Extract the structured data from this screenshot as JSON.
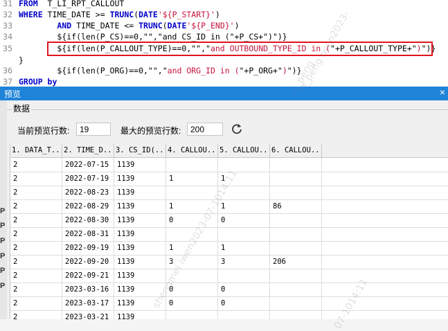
{
  "editor": {
    "lines": [
      {
        "num": "31",
        "segments": [
          [
            "kw",
            "FROM"
          ],
          [
            "",
            "  T_LI_RPT_CALLOUT"
          ]
        ]
      },
      {
        "num": "32",
        "segments": [
          [
            "kw",
            "WHERE"
          ],
          [
            "",
            " TIME_DATE >= "
          ],
          [
            "kw",
            "TRUNC"
          ],
          [
            "",
            "("
          ],
          [
            "kw",
            "DATE"
          ],
          [
            "str",
            "'${P_START}'"
          ],
          [
            "",
            ")"
          ]
        ]
      },
      {
        "num": "33",
        "segments": [
          [
            "",
            "        "
          ],
          [
            "kw",
            "AND"
          ],
          [
            "",
            " TIME_DATE <= "
          ],
          [
            "kw",
            "TRUNC"
          ],
          [
            "",
            "("
          ],
          [
            "kw",
            "DATE"
          ],
          [
            "str",
            "'${P_END}'"
          ],
          [
            "",
            ")"
          ]
        ]
      },
      {
        "num": "34",
        "segments": [
          [
            "",
            "        ${if(len(P_CS)==0,\"\",\"and CS_ID in (\"+P_CS+\")\")}"
          ]
        ]
      },
      {
        "num": "35",
        "segments": [
          [
            "",
            "        ${if(len(P_CALLOUT_TYPE)==0,\"\",\""
          ],
          [
            "str",
            "and OUTBOUND_TYPE_ID in ("
          ],
          [
            "",
            "\"+P_CALLOUT_TYPE+\""
          ],
          [
            "str",
            ")"
          ],
          [
            "",
            "\")}"
          ]
        ]
      },
      {
        "num": "",
        "segments": [
          [
            "",
            "}"
          ]
        ]
      },
      {
        "num": "36",
        "segments": [
          [
            "",
            "        ${if(len(P_ORG)==0,\"\",\""
          ],
          [
            "str",
            "and ORG_ID in ("
          ],
          [
            "",
            "\"+P_ORG+\""
          ],
          [
            "str",
            ")"
          ],
          [
            "",
            "\")}"
          ]
        ]
      },
      {
        "num": "37",
        "segments": [
          [
            "kw",
            "GROUP by"
          ]
        ]
      }
    ]
  },
  "window": {
    "title": "预览",
    "close": "×",
    "group_label": "数据",
    "edge_letters": [
      "P",
      "P",
      "P",
      "P",
      "P",
      "P"
    ]
  },
  "controls": {
    "current_rows_label": "当前预览行数:",
    "current_rows_value": "19",
    "max_rows_label": "最大的预览行数:",
    "max_rows_value": "200"
  },
  "table": {
    "headers": [
      "1. DATA_T...",
      "2. TIME_D...",
      "3. CS_ID(...",
      "4. CALLOU...",
      "5. CALLOU...",
      "6. CALLOU...",
      ""
    ],
    "rows": [
      [
        "2",
        "2022-07-15",
        "1139",
        "",
        "",
        "",
        ""
      ],
      [
        "2",
        "2022-07-19",
        "1139",
        "1",
        "1",
        "",
        ""
      ],
      [
        "2",
        "2022-08-23",
        "1139",
        "",
        "",
        "",
        ""
      ],
      [
        "2",
        "2022-08-29",
        "1139",
        "1",
        "1",
        "86",
        ""
      ],
      [
        "2",
        "2022-08-30",
        "1139",
        "0",
        "0",
        "",
        ""
      ],
      [
        "2",
        "2022-08-31",
        "1139",
        "",
        "",
        "",
        ""
      ],
      [
        "2",
        "2022-09-19",
        "1139",
        "1",
        "1",
        "",
        ""
      ],
      [
        "2",
        "2022-09-20",
        "1139",
        "3",
        "3",
        "206",
        ""
      ],
      [
        "2",
        "2022-09-21",
        "1139",
        "",
        "",
        "",
        ""
      ],
      [
        "2",
        "2023-03-16",
        "1139",
        "0",
        "0",
        "",
        ""
      ],
      [
        "2",
        "2023-03-17",
        "1139",
        "0",
        "0",
        "",
        ""
      ],
      [
        "2",
        "2023-03-21",
        "1139",
        "",
        "",
        "",
        ""
      ]
    ]
  },
  "watermarks": [
    "o_peng  iwen2023-",
    "shengmei iwen2023-07-1014:11",
    "07-1014:11",
    "c_peng"
  ],
  "colors": {
    "titlebar": "#1f83d8",
    "highlight_border": "#e0141e",
    "keyword": "#0000c8",
    "string": "#c4143c"
  }
}
